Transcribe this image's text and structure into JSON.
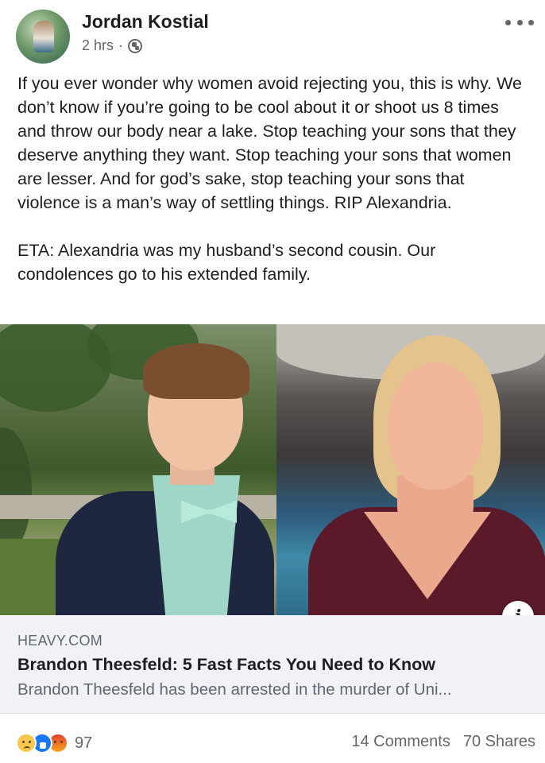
{
  "post": {
    "author": "Jordan Kostial",
    "time": "2 hrs",
    "separator": "·",
    "audience_icon": "globe-icon",
    "more_icon": "more-options-icon",
    "paragraphs": [
      "If you ever wonder why women avoid rejecting you, this is why. We don’t know if you’re going to be cool about it or shoot us 8 times and throw our body near a lake. Stop teaching your sons that they deserve anything they want. Stop teaching your sons that women are lesser. And for god’s sake, stop teaching your sons that violence is a man’s way of settling things. RIP Alexandria.",
      "ETA: Alexandria was my husband’s second cousin. Our condolences go to his extended family."
    ]
  },
  "link": {
    "info_label": "i",
    "domain": "HEAVY.COM",
    "title": "Brandon Theesfeld: 5 Fast Facts You Need to Know",
    "description": "Brandon Theesfeld has been arrested in the murder of Uni..."
  },
  "footer": {
    "reactions_icons": [
      "sad-reaction-icon",
      "like-reaction-icon",
      "angry-reaction-icon"
    ],
    "reaction_count": "97",
    "comments": "14 Comments",
    "shares": "70 Shares"
  },
  "colors": {
    "text": "#1c1e21",
    "secondary": "#65676b",
    "link_bg": "#f0f2f5",
    "like_blue": "#1877f2"
  }
}
